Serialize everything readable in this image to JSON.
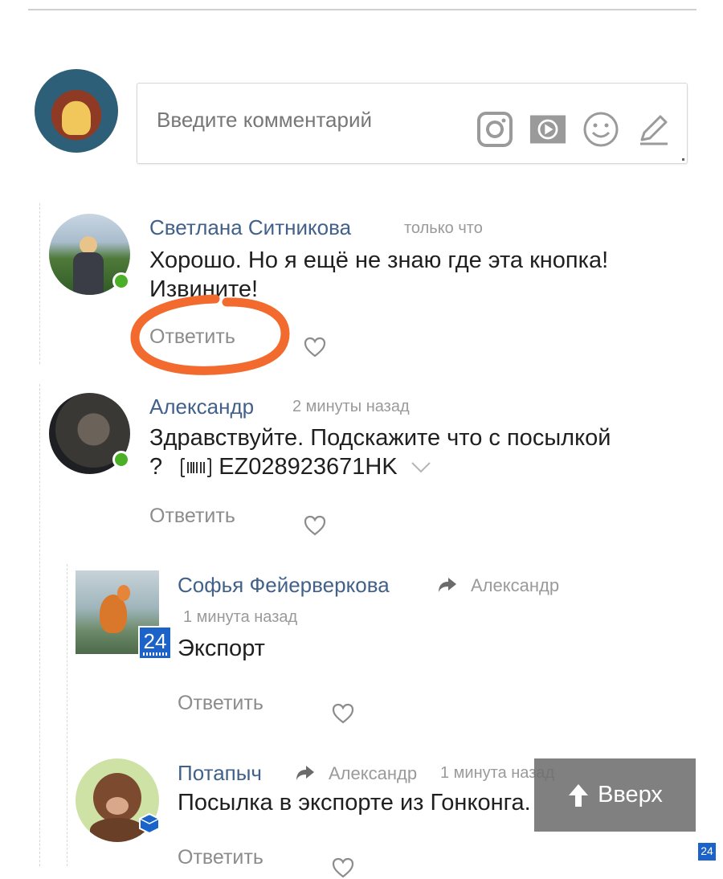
{
  "composer": {
    "placeholder": "Введите комментарий",
    "icons": [
      "instagram-icon",
      "video-icon",
      "emoji-icon",
      "pen-icon"
    ]
  },
  "comments": [
    {
      "author": "Светлана Ситникова",
      "time": "только что",
      "text_line1": "Хорошо. Но я ещё не знаю где эта кнопка!",
      "text_line2": "Извините!",
      "reply_label": "Ответить",
      "online": true
    },
    {
      "author": "Александр",
      "time": "2 минуты назад",
      "text_line1": "Здравствуйте. Подскажите что с посылкой",
      "text_line2_prefix": "?",
      "tracking_number": "EZ028923671HK",
      "reply_label": "Ответить",
      "online": true
    }
  ],
  "replies": [
    {
      "author": "Софья Фейерверкова",
      "reply_to": "Александр",
      "time": "1 минута назад",
      "text": "Экспорт",
      "reply_label": "Ответить",
      "badge": "24"
    },
    {
      "author": "Потапыч",
      "reply_to": "Александр",
      "time": "1 минута назад",
      "text": "Посылка в экспорте из Гонконга.",
      "reply_label": "Ответить"
    }
  ],
  "scroll_top": {
    "label": "Вверх"
  },
  "corner_badge": "24",
  "colors": {
    "author": "#41618a",
    "online": "#4caf28",
    "annotation": "#f26a2e",
    "badge": "#1c63c9"
  }
}
